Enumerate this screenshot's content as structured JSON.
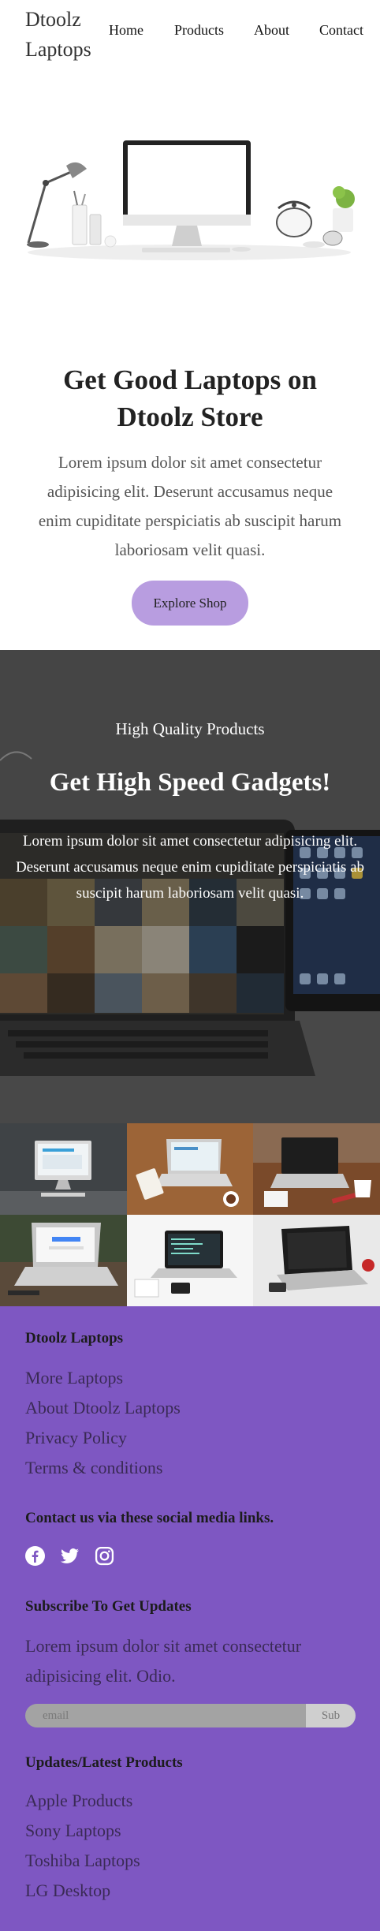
{
  "nav": {
    "brand": "Dtoolz Laptops",
    "links": [
      "Home",
      "Products",
      "About",
      "Contact"
    ]
  },
  "hero": {
    "title": "Get Good Laptops on Dtoolz Store",
    "text": "Lorem ipsum dolor sit amet consectetur adipisicing elit. Deserunt accusamus neque enim cupiditate perspiciatis ab suscipit harum laboriosam velit quasi.",
    "button": "Explore Shop"
  },
  "banner": {
    "subtitle": "High Quality Products",
    "title": "Get High Speed Gadgets!",
    "text": "Lorem ipsum dolor sit amet consectetur adipisicing elit. Deserunt accusamus neque enim cupiditate perspiciatis ab suscipit harum laboriosam velit quasi."
  },
  "footer": {
    "brand_heading": "Dtoolz Laptops",
    "links": [
      "More Laptops",
      "About Dtoolz Laptops",
      "Privacy Policy",
      "Terms & conditions"
    ],
    "social_heading": "Contact us via these social media links.",
    "social_icons": [
      "facebook-icon",
      "twitter-icon",
      "instagram-icon"
    ],
    "subscribe_heading": "Subscribe To Get Updates",
    "subscribe_text": "Lorem ipsum dolor sit amet consectetur adipisicing elit. Odio.",
    "email_placeholder": "email",
    "subscribe_button": "Sub",
    "latest_heading": "Updates/Latest Products",
    "latest_links": [
      "Apple Products",
      "Sony Laptops",
      "Toshiba Laptops",
      "LG Desktop"
    ]
  },
  "colors": {
    "accent_button": "#b89de0",
    "footer_bg": "#7e57c2"
  }
}
